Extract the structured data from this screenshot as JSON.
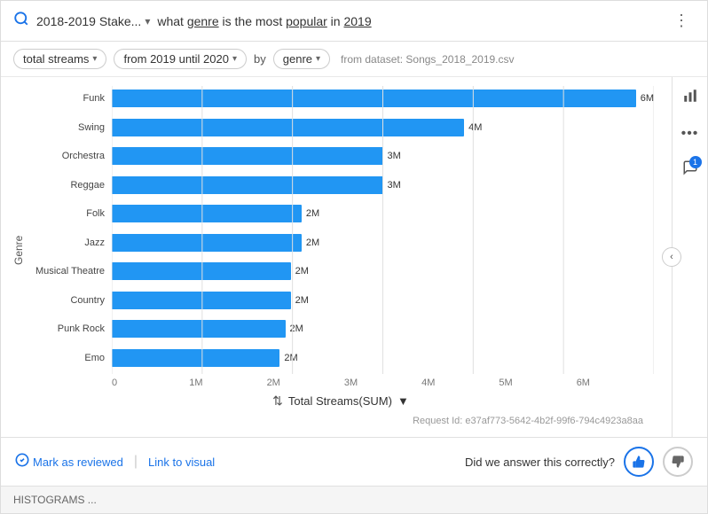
{
  "header": {
    "icon": "🔍",
    "breadcrumb": "2018-2019 Stake...",
    "question_prefix": "what ",
    "question_genre": "genre",
    "question_middle": " is the most ",
    "question_popular": "popular",
    "question_suffix": " in ",
    "question_year": "2019",
    "more_icon": "⋮"
  },
  "filters": {
    "streams_label": "total streams",
    "date_label": "from 2019 until 2020",
    "by_label": "by",
    "genre_label": "genre",
    "dataset_label": "from dataset: Songs_2018_2019.csv"
  },
  "chart": {
    "y_axis_label": "Genre",
    "sort_label": "Total Streams(SUM)",
    "sort_arrow": "▼",
    "bars": [
      {
        "label": "Funk",
        "value": "6M",
        "pct": 98
      },
      {
        "label": "Swing",
        "value": "4M",
        "pct": 65
      },
      {
        "label": "Orchestra",
        "value": "3M",
        "pct": 50
      },
      {
        "label": "Reggae",
        "value": "3M",
        "pct": 50
      },
      {
        "label": "Folk",
        "value": "2M",
        "pct": 35
      },
      {
        "label": "Jazz",
        "value": "2M",
        "pct": 35
      },
      {
        "label": "Musical Theatre",
        "value": "2M",
        "pct": 33
      },
      {
        "label": "Country",
        "value": "2M",
        "pct": 33
      },
      {
        "label": "Punk Rock",
        "value": "2M",
        "pct": 32
      },
      {
        "label": "Emo",
        "value": "2M",
        "pct": 31
      }
    ],
    "x_ticks": [
      "0",
      "1M",
      "2M",
      "3M",
      "4M",
      "5M",
      "6M"
    ],
    "gridline_positions": [
      0,
      16.67,
      33.33,
      50,
      66.67,
      83.33,
      100
    ]
  },
  "request_id": "Request Id: e37af773-5642-4b2f-99f6-794c4923a8aa",
  "footer": {
    "mark_reviewed": "Mark as reviewed",
    "link_visual": "Link to visual",
    "feedback_question": "Did we answer this correctly?",
    "thumbs_up": "👍",
    "thumbs_down": "👎"
  },
  "bottom_strip": {
    "text": "HISTOGRAMS ..."
  },
  "side_panel": {
    "chart_icon": "📊",
    "more_icon": "•••",
    "comment_icon": "💬",
    "badge": "1"
  }
}
